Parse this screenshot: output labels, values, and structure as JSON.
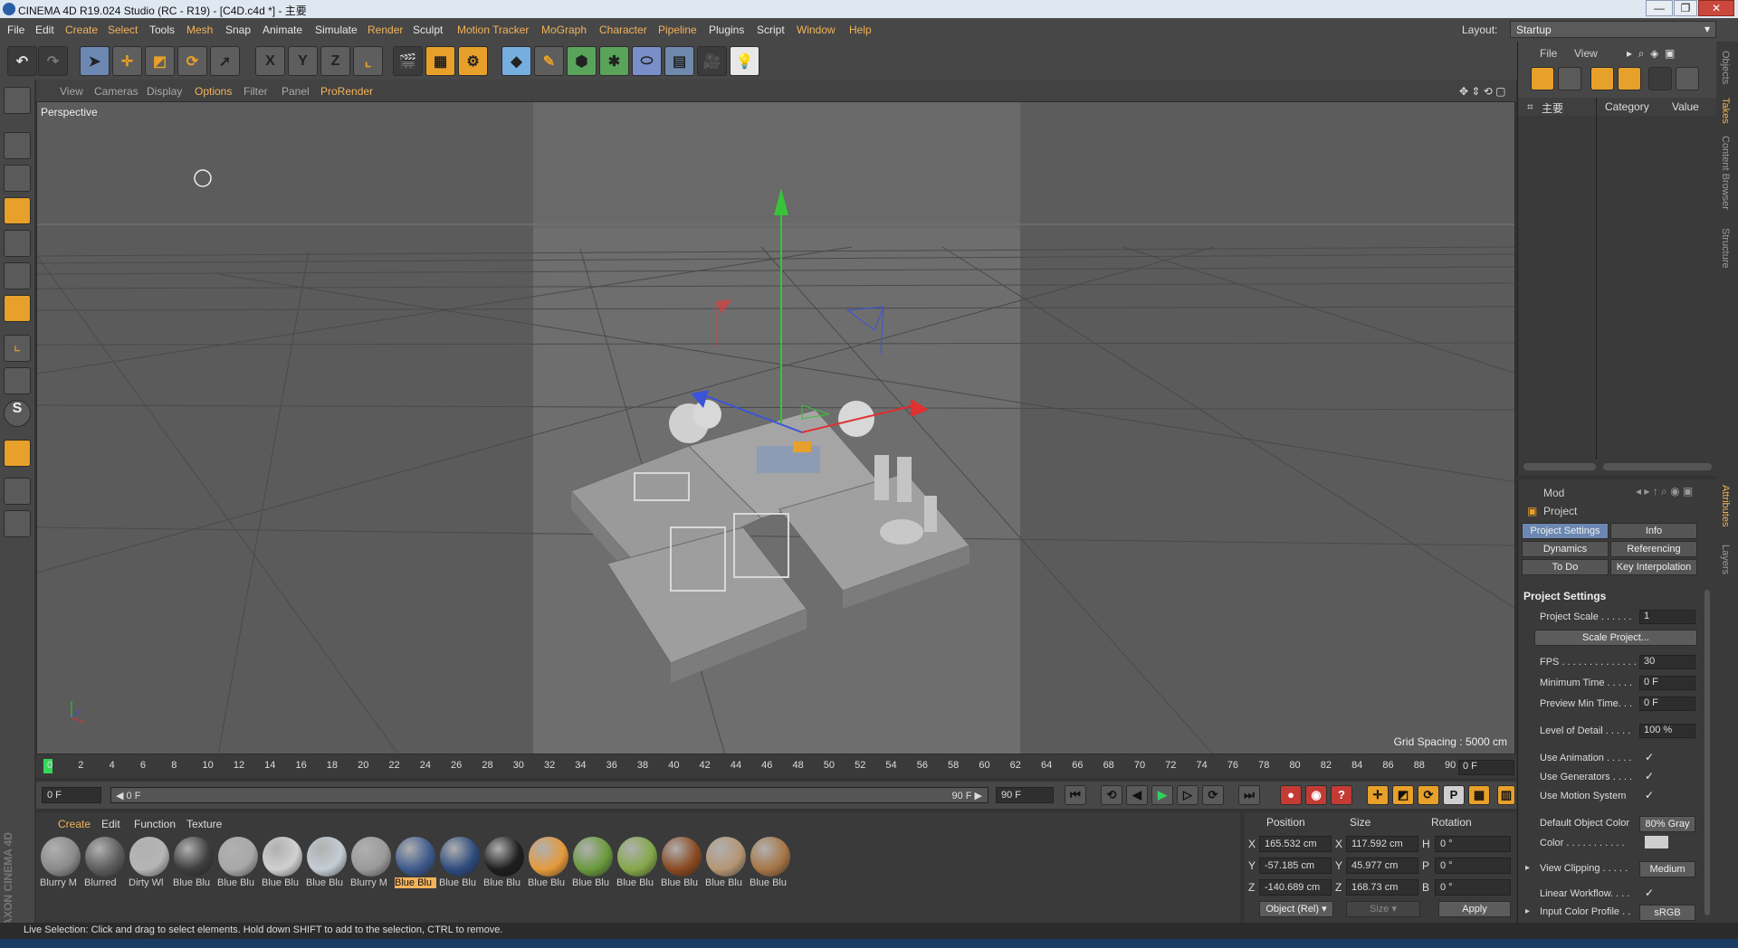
{
  "window": {
    "title": "CINEMA 4D R19.024 Studio (RC - R19) - [C4D.c4d *] - 主要",
    "controls": [
      "—",
      "❐",
      "✕"
    ]
  },
  "menu": [
    "File",
    "Edit",
    "Create",
    "Select",
    "Tools",
    "Mesh",
    "Snap",
    "Animate",
    "Simulate",
    "Render",
    "Sculpt",
    "Motion Tracker",
    "MoGraph",
    "Character",
    "Pipeline",
    "Plugins",
    "Script",
    "Window",
    "Help"
  ],
  "layout": {
    "label": "Layout:",
    "value": "Startup"
  },
  "toolbar": {
    "undo": "↶",
    "redo": "↷",
    "x": "X",
    "y": "Y",
    "z": "Z"
  },
  "viewport_menu": [
    "View",
    "Cameras",
    "Display",
    "Options",
    "Filter",
    "Panel",
    "ProRender"
  ],
  "viewport": {
    "camera": "Perspective",
    "grid_spacing": "Grid Spacing : 5000 cm"
  },
  "timeline": {
    "ticks": [
      "0",
      "2",
      "4",
      "6",
      "8",
      "10",
      "12",
      "14",
      "16",
      "18",
      "20",
      "22",
      "24",
      "26",
      "28",
      "30",
      "32",
      "34",
      "36",
      "38",
      "40",
      "42",
      "44",
      "46",
      "48",
      "50",
      "52",
      "54",
      "56",
      "58",
      "60",
      "62",
      "64",
      "66",
      "68",
      "70",
      "72",
      "74",
      "76",
      "78",
      "80",
      "82",
      "84",
      "86",
      "88",
      "90"
    ],
    "current_frame": "0 F"
  },
  "transport": {
    "start": "0 F",
    "range_start": "◀ 0 F",
    "range_end": "90 F ▶",
    "end": "90 F"
  },
  "materials": {
    "tabs": [
      "Create",
      "Edit",
      "Function",
      "Texture"
    ],
    "items": [
      {
        "label": "Blurry M",
        "color": "#8a8a8a"
      },
      {
        "label": "Blurred",
        "color": "#5d5d5d"
      },
      {
        "label": "Dirty Wl",
        "color": "#b5b5b5"
      },
      {
        "label": "Blue Blu",
        "color": "#3e3e3e"
      },
      {
        "label": "Blue Blu",
        "color": "#a8a8a8"
      },
      {
        "label": "Blue Blu",
        "color": "#d0d0d0"
      },
      {
        "label": "Blue Blu",
        "color": "#c4ccd4"
      },
      {
        "label": "Blurry M",
        "color": "#9a9a9a"
      },
      {
        "label": "Blue Blu",
        "color": "#3d5a8c"
      },
      {
        "label": "Blue Blu",
        "color": "#2f4c7e"
      },
      {
        "label": "Blue Blu",
        "color": "#1e1e1e"
      },
      {
        "label": "Blue Blu",
        "color": "#e59a3c"
      },
      {
        "label": "Blue Blu",
        "color": "#6a9a3d"
      },
      {
        "label": "Blue Blu",
        "color": "#85a84a"
      },
      {
        "label": "Blue Blu",
        "color": "#8a4a22"
      },
      {
        "label": "Blue Blu",
        "color": "#b59674"
      },
      {
        "label": "Blue Blu",
        "color": "#a77646"
      }
    ]
  },
  "coordinates": {
    "headers": [
      "Position",
      "Size",
      "Rotation"
    ],
    "rows": [
      {
        "axis": "X",
        "pos": "165.532 cm",
        "saxis": "X",
        "size": "117.592 cm",
        "raxis": "H",
        "rot": "0 °"
      },
      {
        "axis": "Y",
        "pos": "-57.185 cm",
        "saxis": "Y",
        "size": "45.977 cm",
        "raxis": "P",
        "rot": "0 °"
      },
      {
        "axis": "Z",
        "pos": "-140.689 cm",
        "saxis": "Z",
        "size": "168.73 cm",
        "raxis": "B",
        "rot": "0 °"
      }
    ],
    "mode": "Object (Rel)",
    "size_mode": "Size",
    "apply": "Apply"
  },
  "status": "Live Selection: Click and drag to select elements. Hold down SHIFT to add to the selection, CTRL to remove.",
  "objects_panel": {
    "menu": [
      "File",
      "View"
    ],
    "columns": [
      "主要",
      "Category",
      "Value"
    ]
  },
  "attributes": {
    "mode": "Mod",
    "object": "Project",
    "tabs": [
      "Project Settings",
      "Info",
      "Dynamics",
      "Referencing",
      "To Do",
      "Key Interpolation"
    ],
    "section": "Project Settings",
    "project_scale": {
      "label": "Project Scale . . . . . .",
      "value": "1"
    },
    "scale_button": "Scale Project...",
    "fps": {
      "label": "FPS . . . . . . . . . . . . . . .",
      "value": "30"
    },
    "min_time": {
      "label": "Minimum Time . . . . .",
      "value": "0 F"
    },
    "preview_min": {
      "label": "Preview Min Time. . .",
      "value": "0 F"
    },
    "lod": {
      "label": "Level of Detail . . . . .",
      "value": "100 %"
    },
    "use_animation": "Use Animation . . . . .",
    "use_generators": "Use Generators . . . .",
    "use_motion": "Use Motion System",
    "default_color": {
      "label": "Default Object Color",
      "value": "80% Gray"
    },
    "color": "Color . . . . . . . . . . .",
    "view_clipping": {
      "label": "View Clipping . . . . .",
      "value": "Medium"
    },
    "linear_workflow": "Linear Workflow. . . .",
    "input_profile": {
      "label": "Input Color Profile . .",
      "value": "sRGB"
    },
    "check": "✓"
  },
  "side_tabs": [
    "Objects",
    "Takes",
    "Content Browser",
    "Structure",
    "Attributes",
    "Layers"
  ],
  "brand": "MAXON CINEMA 4D"
}
